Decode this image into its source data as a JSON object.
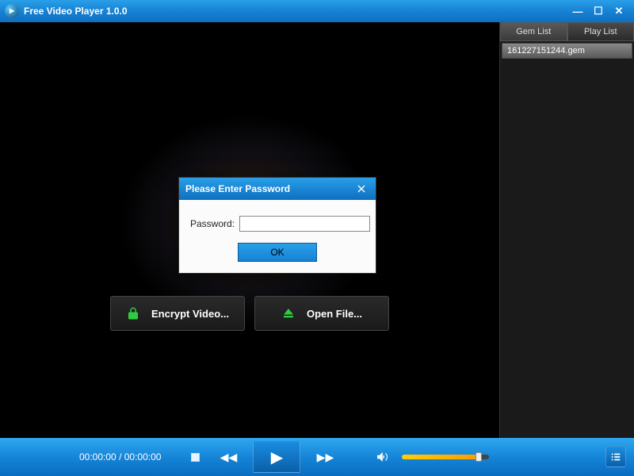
{
  "titlebar": {
    "title": "Free Video Player 1.0.0"
  },
  "sidebar": {
    "tabs": [
      {
        "label": "Gem List"
      },
      {
        "label": "Play List"
      }
    ],
    "items": [
      {
        "label": "161227151244.gem"
      }
    ]
  },
  "actions": {
    "encrypt_label": "Encrypt Video...",
    "open_label": "Open File..."
  },
  "dialog": {
    "title": "Please Enter Password",
    "field_label": "Password:",
    "input_value": "",
    "ok_label": "OK"
  },
  "controls": {
    "time_current": "00:00:00",
    "time_total": "00:00:00",
    "volume_percent": 88
  }
}
